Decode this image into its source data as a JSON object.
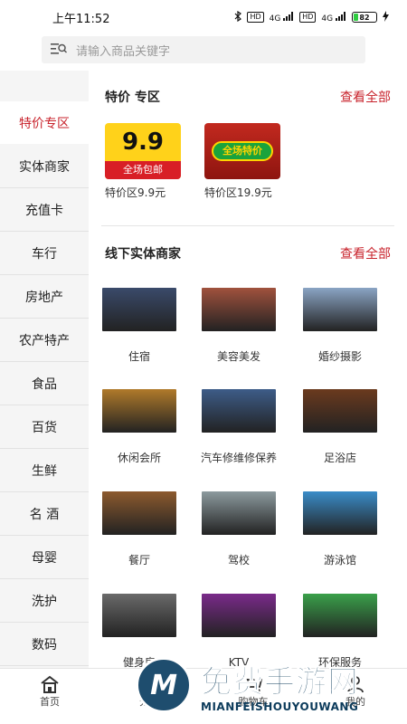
{
  "status": {
    "time": "上午11:52",
    "signal1": "4G",
    "signal2": "4G",
    "hd1": "HD",
    "hd2": "HD",
    "battery": "82"
  },
  "search": {
    "placeholder": "请输入商品关键字"
  },
  "sidebar": {
    "items": [
      {
        "label": "特价专区"
      },
      {
        "label": "实体商家"
      },
      {
        "label": "充值卡"
      },
      {
        "label": "车行"
      },
      {
        "label": "房地产"
      },
      {
        "label": "农产特产"
      },
      {
        "label": "食品"
      },
      {
        "label": "百货"
      },
      {
        "label": "生鲜"
      },
      {
        "label": "名 酒"
      },
      {
        "label": "母婴"
      },
      {
        "label": "洗护"
      },
      {
        "label": "数码"
      }
    ]
  },
  "specials": {
    "title": "特价 专区",
    "more": "查看全部",
    "items": [
      {
        "caption": "特价区9.9元",
        "badge_big": "9.9",
        "badge_band": "全场包邮"
      },
      {
        "caption": "特价区19.9元",
        "badge_text": "全场特价"
      }
    ]
  },
  "merchants": {
    "title": "线下实体商家",
    "more": "查看全部",
    "items": [
      {
        "label": "住宿",
        "color": "#3a4a6a"
      },
      {
        "label": "美容美发",
        "color": "#a0523d"
      },
      {
        "label": "婚纱摄影",
        "color": "#8aa4c4"
      },
      {
        "label": "休闲会所",
        "color": "#b07a2a"
      },
      {
        "label": "汽车修维修保养",
        "color": "#3d5c88"
      },
      {
        "label": "足浴店",
        "color": "#6b3a1e"
      },
      {
        "label": "餐厅",
        "color": "#8c5a2e"
      },
      {
        "label": "驾校",
        "color": "#8c9a9e"
      },
      {
        "label": "游泳馆",
        "color": "#3a8cc8"
      },
      {
        "label": "健身房",
        "color": "#6a6a6a"
      },
      {
        "label": "KTV",
        "color": "#7a2a8a"
      },
      {
        "label": "环保服务",
        "color": "#3aa04a"
      }
    ]
  },
  "tabbar": {
    "tabs": [
      {
        "label": "首页"
      },
      {
        "label": "分类"
      },
      {
        "label": "购物车"
      },
      {
        "label": "我的"
      }
    ]
  },
  "watermark": {
    "title": "免费手游网",
    "subtitle": "MIANFEISHOUYOUWANG",
    "logo_letter": "M"
  },
  "colors": {
    "accent": "#c8232c",
    "sidebar_bg": "#f5f5f5"
  }
}
